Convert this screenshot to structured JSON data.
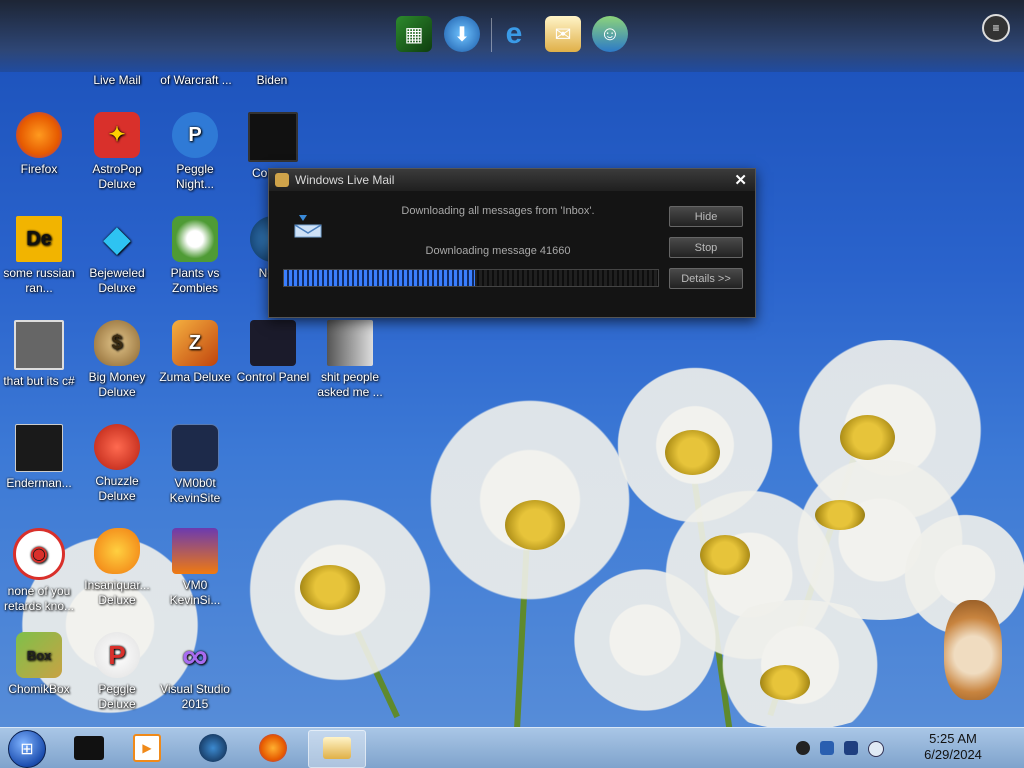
{
  "top_dock": {
    "partial_labels": [
      "Live Mail",
      "of Warcraft ...",
      "Biden"
    ],
    "icons": [
      "spreadsheet-icon",
      "internet-download-icon",
      "internet-explorer-icon",
      "mail-icon",
      "contacts-icon"
    ],
    "menu_icon": "gear-icon"
  },
  "desktop": {
    "icons": [
      {
        "name": "firefox",
        "label": "Firefox",
        "color": "#e66000"
      },
      {
        "name": "astropop",
        "label": "AstroPop Deluxe",
        "color": "#d9302b"
      },
      {
        "name": "peggle-nights",
        "label": "Peggle Night...",
        "color": "#2f7ad6"
      },
      {
        "name": "computer",
        "label": "Comp...",
        "color": "#111111"
      },
      {
        "name": "some-russian",
        "label": "some russian ran...",
        "color": "#f2b400"
      },
      {
        "name": "bejeweled",
        "label": "Bejeweled Deluxe",
        "color": "#2ec3f2"
      },
      {
        "name": "plants-vs-zombies",
        "label": "Plants vs Zombies",
        "color": "#4f9b35"
      },
      {
        "name": "network",
        "label": "Net...",
        "color": "#2a6e9e"
      },
      {
        "name": "that-but-csharp",
        "label": "that but its c#",
        "color": "#d0d0d0"
      },
      {
        "name": "big-money",
        "label": "Big Money Deluxe",
        "color": "#b58b45"
      },
      {
        "name": "zuma",
        "label": "Zuma Deluxe",
        "color": "#d9641a"
      },
      {
        "name": "control-panel",
        "label": "Control Panel",
        "color": "#222233"
      },
      {
        "name": "shit-people",
        "label": "shit people asked me ...",
        "color": "#cfcfcf"
      },
      {
        "name": "enderman",
        "label": "Enderman...",
        "color": "#222222"
      },
      {
        "name": "chuzzle",
        "label": "Chuzzle Deluxe",
        "color": "#e23a2a"
      },
      {
        "name": "vm0b0t-kevinsite",
        "label": "VM0b0t KevinSite",
        "color": "#1d2a4a"
      },
      {
        "name": "none-of-you",
        "label": "none of you retards kno...",
        "color": "#d9302b"
      },
      {
        "name": "insaniquarium",
        "label": "Insaniquar... Deluxe",
        "color": "#f29b1a"
      },
      {
        "name": "vm0-kevinsi",
        "label": "VM0 KevinSi...",
        "color": "#6b3ab0"
      },
      {
        "name": "chomikbox",
        "label": "ChomikBox",
        "color": "#c8a244"
      },
      {
        "name": "peggle",
        "label": "Peggle Deluxe",
        "color": "#f0f0f0"
      },
      {
        "name": "visual-studio",
        "label": "Visual Studio 2015",
        "color": "#7a3fb5"
      }
    ]
  },
  "dialog": {
    "title": "Windows Live Mail",
    "close": "✕",
    "status1": "Downloading all messages from 'Inbox'.",
    "status2": "Downloading message 41660",
    "progress": 0.51,
    "buttons": {
      "hide": "Hide",
      "stop": "Stop",
      "details": "Details >>"
    }
  },
  "taskbar": {
    "time": "5:25 AM",
    "date": "6/29/2024"
  }
}
